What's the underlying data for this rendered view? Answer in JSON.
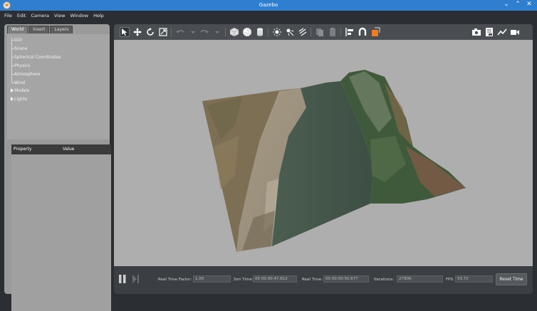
{
  "window": {
    "title": "Gazebo"
  },
  "menu": [
    "File",
    "Edit",
    "Camera",
    "View",
    "Window",
    "Help"
  ],
  "left_panel": {
    "tabs": [
      "World",
      "Insert",
      "Layers"
    ],
    "active_tab": "World",
    "tree": [
      {
        "label": "GUI",
        "expandable": false
      },
      {
        "label": "Scene",
        "expandable": false
      },
      {
        "label": "Spherical Coordinates",
        "expandable": false
      },
      {
        "label": "Physics",
        "expandable": false
      },
      {
        "label": "Atmosphere",
        "expandable": false
      },
      {
        "label": "Wind",
        "expandable": false
      },
      {
        "label": "Models",
        "expandable": true
      },
      {
        "label": "Lights",
        "expandable": true
      }
    ],
    "property_header": {
      "property": "Property",
      "value": "Value"
    }
  },
  "toolbar": {
    "icons": [
      "select-mode-icon",
      "translate-mode-icon",
      "rotate-mode-icon",
      "scale-mode-icon",
      "undo-icon",
      "undo-history-icon",
      "redo-icon",
      "redo-history-icon",
      "box-shape-icon",
      "sphere-shape-icon",
      "cylinder-shape-icon",
      "point-light-icon",
      "spot-light-icon",
      "directional-light-icon",
      "copy-icon",
      "paste-icon",
      "align-icon",
      "snap-icon",
      "change-view-icon",
      "screenshot-icon",
      "log-icon",
      "plot-icon",
      "record-video-icon"
    ],
    "accent_color": "#f07d1e"
  },
  "bottom_bar": {
    "real_time_factor": {
      "label": "Real Time Factor:",
      "value": "1.00"
    },
    "sim_time": {
      "label": "Sim Time:",
      "value": "00 00:00:47.812"
    },
    "real_time": {
      "label": "Real Time:",
      "value": "00 00:00:50.677"
    },
    "iterations": {
      "label": "Iterations:",
      "value": "27906"
    },
    "fps": {
      "label": "FPS:",
      "value": "53.72"
    },
    "reset_label": "Reset Time"
  }
}
